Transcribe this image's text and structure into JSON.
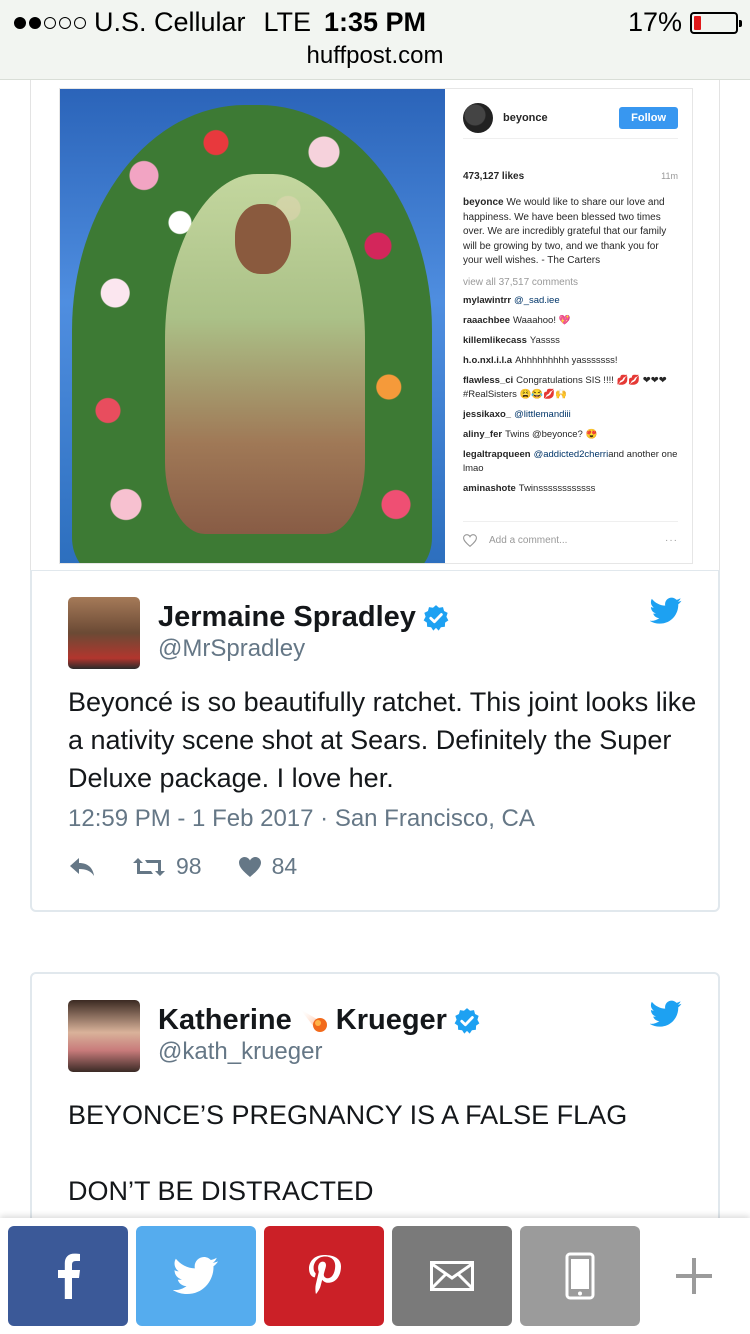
{
  "status_bar": {
    "carrier": "U.S. Cellular",
    "network": "LTE",
    "time": "1:35 PM",
    "battery": "17%",
    "battery_level": 0.17,
    "url": "huffpost.com"
  },
  "instagram": {
    "username": "beyonce",
    "follow_label": "Follow",
    "likes": "473,127 likes",
    "age": "11m",
    "caption_user": "beyonce",
    "caption": "We would like to share our love and happiness. We have been blessed two times over. We are incredibly grateful that our family will be growing by two, and we thank you for your well wishes. - The Carters",
    "view_all": "view all 37,517 comments",
    "comments": [
      {
        "user": "mylawintrr",
        "mention": "@_sad.iee",
        "text": ""
      },
      {
        "user": "raaachbee",
        "mention": "",
        "text": "Waaahoo! 💖"
      },
      {
        "user": "killemlikecass",
        "mention": "",
        "text": "Yassss"
      },
      {
        "user": "h.o.nxl.i.l.a",
        "mention": "",
        "text": "Ahhhhhhhhh yasssssss!"
      },
      {
        "user": "flawless_ci",
        "mention": "",
        "text": "Congratulations SIS !!!! 💋💋 ❤❤❤ #RealSisters 😩😂💋🙌"
      },
      {
        "user": "jessikaxo_",
        "mention": "@littlemandiii",
        "text": ""
      },
      {
        "user": "aliny_fer",
        "mention": "",
        "text": "Twins @beyonce? 😍"
      },
      {
        "user": "legaltrapqueen",
        "mention": "@addicted2cherri",
        "text": "and another one lmao"
      },
      {
        "user": "aminashote",
        "mention": "",
        "text": "Twinssssssssssss"
      }
    ],
    "add_comment": "Add a comment...",
    "more": "···"
  },
  "tweet1": {
    "name": "Jermaine Spradley",
    "handle": "@MrSpradley",
    "text": "Beyoncé is so beautifully ratchet. This joint looks like a nativity scene shot at Sears. Definitely the Super Deluxe package. I love her.",
    "meta": "12:59 PM - 1 Feb 2017 · San Francisco, CA",
    "retweets": "98",
    "likes": "84"
  },
  "tweet2": {
    "name_first": "Katherine",
    "name_last": "Krueger",
    "handle": "@kath_krueger",
    "line1": "BEYONCE’S PREGNANCY IS A FALSE FLAG",
    "line2": "DON’T BE DISTRACTED"
  },
  "share_bar": {
    "facebook_icon": "facebook-icon",
    "twitter_icon": "twitter-icon",
    "pinterest_icon": "pinterest-icon",
    "email_icon": "email-icon",
    "sms_icon": "phone-icon",
    "more_icon": "plus-icon"
  },
  "colors": {
    "facebook": "#3b5998",
    "twitter": "#55acee",
    "pinterest": "#cb2027",
    "email": "#7a7a7a",
    "sms": "#9b9b9b",
    "verified": "#1da1f2"
  }
}
